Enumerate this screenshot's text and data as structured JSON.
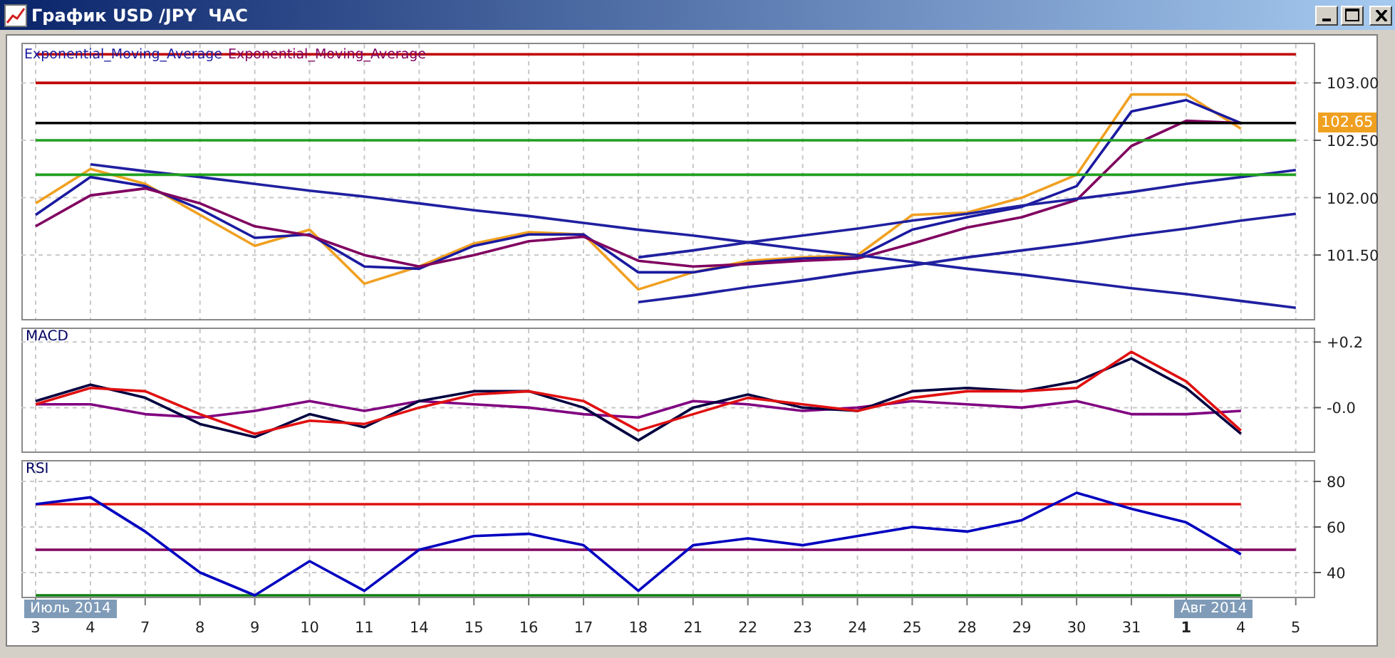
{
  "window": {
    "title": "График USD /JPY  ЧАС"
  },
  "price_panel": {
    "current_price": "102.65",
    "chart_data": {
      "type": "line",
      "grid": true,
      "categories": [
        null,
        null,
        null,
        null,
        null,
        null,
        null,
        null,
        null,
        null,
        null,
        null,
        null,
        null,
        null,
        null,
        null,
        null,
        null,
        null,
        null,
        null,
        null,
        null
      ],
      "ylim": [
        100.93,
        103.35
      ],
      "series": [
        {
          "color": "#f0a020",
          "values": [
            101.95,
            102.25,
            102.12,
            101.85,
            101.58,
            101.72,
            101.25,
            101.4,
            101.6,
            101.7,
            101.68,
            101.2,
            101.35,
            101.45,
            101.48,
            101.5,
            101.85,
            101.87,
            102.0,
            102.2,
            102.9,
            102.9,
            102.6,
            null
          ]
        },
        {
          "name": "Exponential_Moving_Average",
          "color": "#1a1aa0",
          "values": [
            101.85,
            102.18,
            102.1,
            101.9,
            101.65,
            101.68,
            101.4,
            101.38,
            101.58,
            101.68,
            101.68,
            101.35,
            101.35,
            101.43,
            101.47,
            101.48,
            101.72,
            101.83,
            101.92,
            102.1,
            102.75,
            102.85,
            102.65,
            null
          ]
        },
        {
          "name": "Exponential_Moving_Average",
          "color": "#800060",
          "values": [
            101.75,
            102.02,
            102.08,
            101.95,
            101.75,
            101.67,
            101.5,
            101.4,
            101.5,
            101.62,
            101.66,
            101.45,
            101.4,
            101.42,
            101.45,
            101.47,
            101.6,
            101.74,
            101.83,
            101.98,
            102.45,
            102.67,
            102.65,
            null
          ]
        },
        {
          "color": "#2020a0",
          "values": [
            null,
            102.29,
            102.23,
            102.18,
            102.12,
            102.06,
            102.01,
            101.95,
            101.89,
            101.84,
            101.78,
            101.72,
            101.67,
            101.61,
            101.55,
            101.5,
            101.44,
            101.38,
            101.33,
            101.27,
            101.21,
            101.16,
            101.1,
            101.04
          ]
        },
        {
          "color": "#2020a0",
          "values": [
            null,
            null,
            null,
            null,
            null,
            null,
            null,
            null,
            null,
            null,
            null,
            101.09,
            101.15,
            101.22,
            101.28,
            101.35,
            101.41,
            101.48,
            101.54,
            101.6,
            101.67,
            101.73,
            101.8,
            101.86
          ]
        },
        {
          "color": "#2020a0",
          "values": [
            null,
            null,
            null,
            null,
            null,
            null,
            null,
            null,
            null,
            null,
            null,
            101.48,
            101.54,
            101.61,
            101.67,
            101.73,
            101.8,
            101.86,
            101.93,
            101.99,
            102.05,
            102.12,
            102.18,
            102.24
          ]
        },
        {
          "color": "#c00000",
          "values": [
            103.25,
            103.25,
            103.25,
            103.25,
            103.25,
            103.25,
            103.25,
            103.25,
            103.25,
            103.25,
            103.25,
            103.25,
            103.25,
            103.25,
            103.25,
            103.25,
            103.25,
            103.25,
            103.25,
            103.25,
            103.25,
            103.25,
            103.25,
            103.25
          ]
        },
        {
          "color": "#c00000",
          "values": [
            103.0,
            103.0,
            103.0,
            103.0,
            103.0,
            103.0,
            103.0,
            103.0,
            103.0,
            103.0,
            103.0,
            103.0,
            103.0,
            103.0,
            103.0,
            103.0,
            103.0,
            103.0,
            103.0,
            103.0,
            103.0,
            103.0,
            103.0,
            103.0
          ]
        },
        {
          "color": "#000000",
          "values": [
            102.65,
            102.65,
            102.65,
            102.65,
            102.65,
            102.65,
            102.65,
            102.65,
            102.65,
            102.65,
            102.65,
            102.65,
            102.65,
            102.65,
            102.65,
            102.65,
            102.65,
            102.65,
            102.65,
            102.65,
            102.65,
            102.65,
            102.65,
            102.65
          ]
        },
        {
          "color": "#20a020",
          "values": [
            102.5,
            102.5,
            102.5,
            102.5,
            102.5,
            102.5,
            102.5,
            102.5,
            102.5,
            102.5,
            102.5,
            102.5,
            102.5,
            102.5,
            102.5,
            102.5,
            102.5,
            102.5,
            102.5,
            102.5,
            102.5,
            102.5,
            102.5,
            102.5
          ]
        },
        {
          "color": "#20a020",
          "values": [
            102.2,
            102.2,
            102.2,
            102.2,
            102.2,
            102.2,
            102.2,
            102.2,
            102.2,
            102.2,
            102.2,
            102.2,
            102.2,
            102.2,
            102.2,
            102.2,
            102.2,
            102.2,
            102.2,
            102.2,
            102.2,
            102.2,
            102.2,
            102.2
          ]
        }
      ],
      "yticks": [
        {
          "value": 103,
          "label": "103.00"
        },
        {
          "value": 102.5,
          "label": "102.50"
        },
        {
          "value": 102,
          "label": "102.00"
        },
        {
          "value": 101.5,
          "label": "101.50"
        }
      ]
    }
  },
  "macd_panel": {
    "chart_data": {
      "type": "line",
      "grid": true,
      "categories": [
        null,
        null,
        null,
        null,
        null,
        null,
        null,
        null,
        null,
        null,
        null,
        null,
        null,
        null,
        null,
        null,
        null,
        null,
        null,
        null,
        null,
        null,
        null,
        null
      ],
      "ylim": [
        -0.138,
        0.244
      ],
      "series": [
        {
          "color": "#800080",
          "values": [
            0.01,
            0.01,
            -0.02,
            -0.03,
            -0.01,
            0.02,
            -0.01,
            0.02,
            0.01,
            0,
            -0.02,
            -0.03,
            0.02,
            0.01,
            -0.01,
            0,
            0.02,
            0.01,
            0,
            0.02,
            -0.02,
            -0.02,
            -0.01,
            null
          ]
        },
        {
          "name": "MACD",
          "color": "#000040",
          "values": [
            0.02,
            0.07,
            0.03,
            -0.05,
            -0.09,
            -0.02,
            -0.06,
            0.02,
            0.05,
            0.05,
            0.0,
            -0.1,
            0.0,
            0.04,
            0.0,
            -0.01,
            0.05,
            0.06,
            0.05,
            0.08,
            0.15,
            0.06,
            -0.08,
            null
          ]
        },
        {
          "color": "#e01010",
          "values": [
            0.01,
            0.06,
            0.05,
            -0.02,
            -0.08,
            -0.04,
            -0.05,
            0.0,
            0.04,
            0.05,
            0.02,
            -0.07,
            -0.02,
            0.03,
            0.01,
            -0.01,
            0.03,
            0.05,
            0.05,
            0.06,
            0.17,
            0.08,
            -0.07,
            null
          ]
        }
      ],
      "yticks": [
        {
          "value": 0.2,
          "label": "+0.2"
        },
        {
          "value": 0,
          "label": "-0.0"
        }
      ]
    }
  },
  "rsi_panel": {
    "chart_data": {
      "type": "line",
      "grid": true,
      "categories": [
        "3",
        "4",
        "7",
        "8",
        "9",
        "10",
        "11",
        "14",
        "15",
        "16",
        "17",
        "18",
        "21",
        "22",
        "23",
        "24",
        "25",
        "28",
        "29",
        "30",
        "31",
        "1",
        "4",
        "5"
      ],
      "ylim": [
        28.75,
        89.4
      ],
      "series": [
        {
          "color": "#e01010",
          "values": [
            70,
            70,
            70,
            70,
            70,
            70,
            70,
            70,
            70,
            70,
            70,
            70,
            70,
            70,
            70,
            70,
            70,
            70,
            70,
            70,
            70,
            70,
            70,
            null
          ]
        },
        {
          "color": "#800060",
          "values": [
            50,
            50,
            50,
            50,
            50,
            50,
            50,
            50,
            50,
            50,
            50,
            50,
            50,
            50,
            50,
            50,
            50,
            50,
            50,
            50,
            50,
            50,
            50,
            50
          ]
        },
        {
          "color": "#108010",
          "values": [
            30,
            30,
            30,
            30,
            30,
            30,
            30,
            30,
            30,
            30,
            30,
            30,
            30,
            30,
            30,
            30,
            30,
            30,
            30,
            30,
            30,
            30,
            30,
            null
          ]
        },
        {
          "name": "RSI",
          "color": "#0000c0",
          "values": [
            70,
            73,
            58,
            40,
            30,
            45,
            32,
            50,
            56,
            57,
            52,
            32,
            52,
            55,
            52,
            56,
            60,
            58,
            63,
            75,
            68,
            62,
            48,
            null
          ]
        }
      ],
      "yticks": [
        {
          "value": 80,
          "label": "80"
        },
        {
          "value": 60,
          "label": "60"
        },
        {
          "value": 40,
          "label": "40"
        }
      ]
    }
  },
  "time_axis": {
    "months": [
      "Июль 2014",
      "Авг 2014"
    ],
    "month_start": [
      false,
      false,
      false,
      false,
      false,
      false,
      false,
      false,
      false,
      false,
      false,
      false,
      false,
      false,
      false,
      false,
      false,
      false,
      false,
      false,
      false,
      true,
      false,
      false
    ]
  }
}
